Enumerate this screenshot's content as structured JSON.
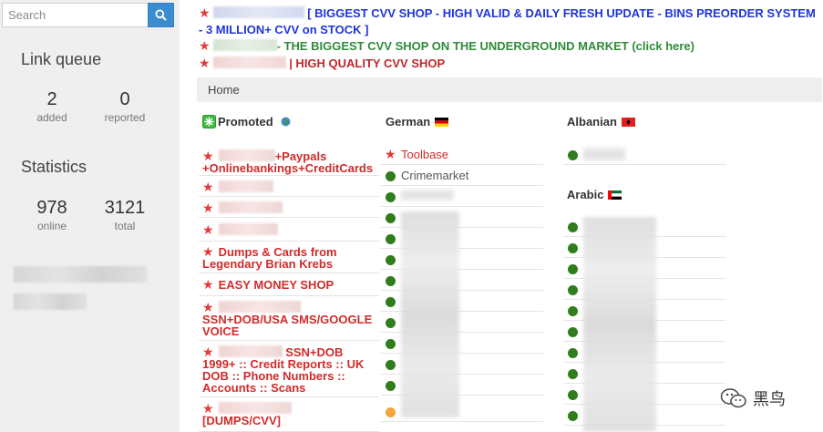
{
  "search": {
    "placeholder": "Search"
  },
  "sidebar": {
    "link_queue_title": "Link queue",
    "added_count": "2",
    "added_label": "added",
    "reported_count": "0",
    "reported_label": "reported",
    "statistics_title": "Statistics",
    "online_count": "978",
    "online_label": "online",
    "total_count": "3121",
    "total_label": "total"
  },
  "ads": [
    {
      "text": "[ BIGGEST CVV SHOP - HIGH VALID & DAILY FRESH UPDATE - BINS PREORDER SYSTEM - 3 MILLION+ CVV on STOCK ]"
    },
    {
      "text": "- THE BIGGEST CVV SHOP ON THE UNDERGROUND MARKET (click here)"
    },
    {
      "text": "| HIGH QUALITY CVV SHOP"
    }
  ],
  "breadcrumb": {
    "home": "Home"
  },
  "columns": {
    "promoted": {
      "title": "Promoted"
    },
    "german": {
      "title": "German"
    },
    "albanian": {
      "title": "Albanian"
    },
    "arabic": {
      "title": "Arabic"
    }
  },
  "promoted_items": [
    "+Paypals +Onlinebankings+CreditCards",
    "",
    "",
    "",
    "Dumps & Cards from Legendary Brian Krebs",
    "EASY MONEY SHOP",
    "SSN+DOB/USA SMS/GOOGLE VOICE",
    "SSN+DOB 1999+ :: Credit Reports :: UK DOB :: Phone Numbers :: Accounts :: Scans",
    "[DUMPS/CVV]"
  ],
  "german_items": [
    "Toolbase",
    "Crimemarket"
  ],
  "watermark": {
    "text": "黑鸟"
  },
  "colors": {
    "search_button": "#3a8dd0",
    "promoted_red": "#d32a2a",
    "online_green": "#2f7d1b",
    "ad_blue": "#1f35d8",
    "ad_green": "#2e8b3a"
  }
}
